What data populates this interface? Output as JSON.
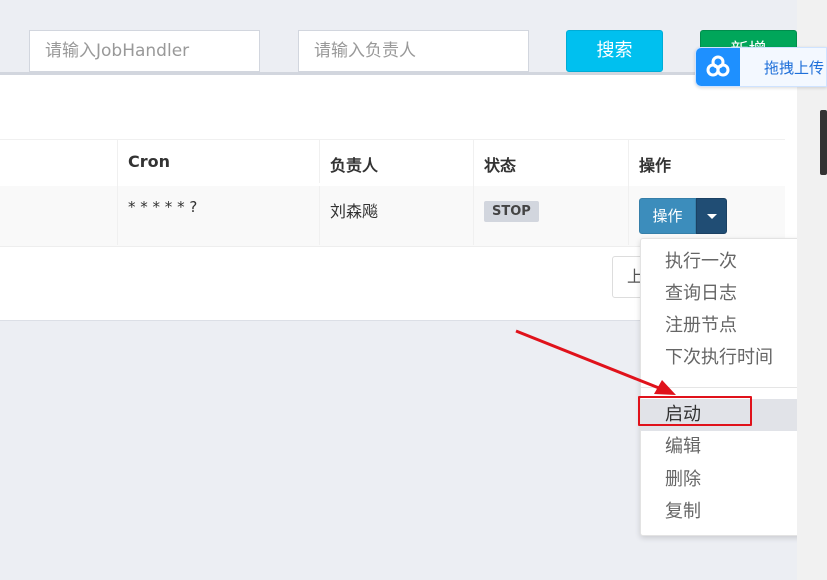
{
  "search": {
    "jobhandler_placeholder": "请输入JobHandler",
    "owner_placeholder": "请输入负责人",
    "search_label": "搜索",
    "add_label": "新增"
  },
  "upload_widget": {
    "label": "拖拽上传",
    "icon": "cloud-link-icon"
  },
  "table": {
    "headers": {
      "cron": "Cron",
      "owner": "负责人",
      "status": "状态",
      "action": "操作"
    },
    "rows": [
      {
        "cron": "* * * * * ?",
        "owner": "刘森飚",
        "status": "STOP",
        "action_label": "操作"
      }
    ]
  },
  "pagination": {
    "prev_label": "上"
  },
  "dropdown_menu": {
    "items": [
      "执行一次",
      "查询日志",
      "注册节点",
      "下次执行时间",
      "启动",
      "编辑",
      "删除",
      "复制"
    ],
    "highlighted": "启动"
  },
  "colors": {
    "search_btn": "#00c0ef",
    "add_btn": "#00a65a",
    "annotation": "#e0121b",
    "action_btn": "#3c8dbc"
  }
}
